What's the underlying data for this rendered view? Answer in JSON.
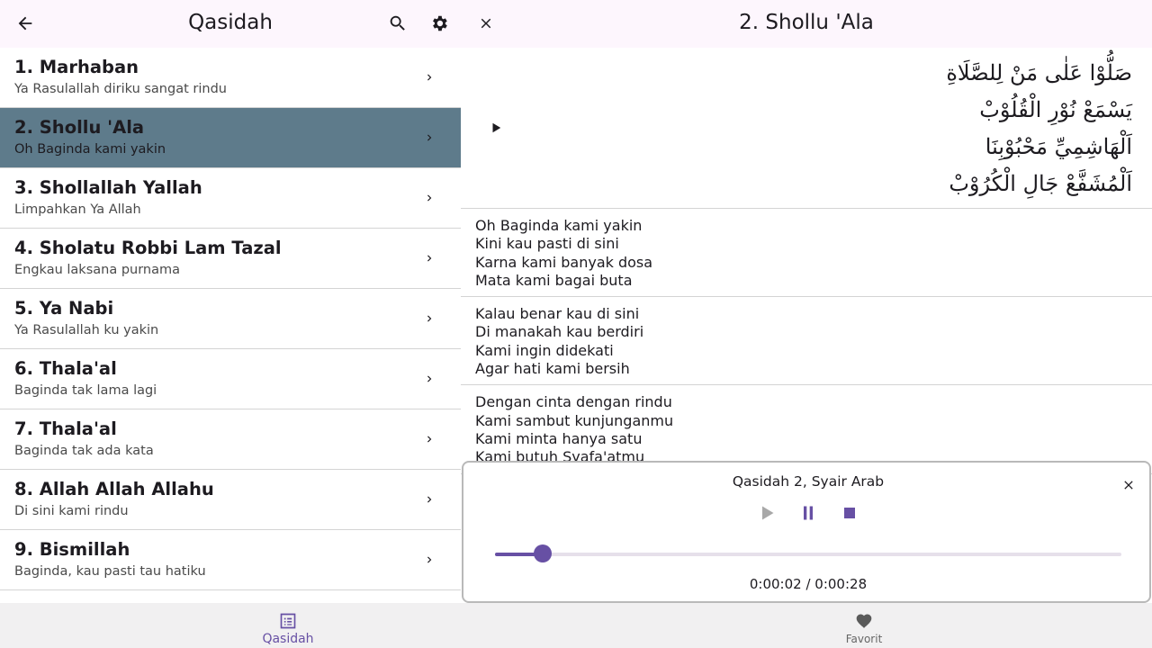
{
  "left": {
    "title": "Qasidah",
    "items": [
      {
        "title": "1. Marhaban",
        "subtitle": "Ya Rasulallah diriku sangat rindu"
      },
      {
        "title": "2. Shollu 'Ala",
        "subtitle": "Oh Baginda kami yakin"
      },
      {
        "title": "3. Shollallah Yallah",
        "subtitle": "Limpahkan Ya Allah"
      },
      {
        "title": "4. Sholatu Robbi Lam Tazal",
        "subtitle": "Engkau laksana purnama"
      },
      {
        "title": "5. Ya Nabi",
        "subtitle": "Ya Rasulallah ku yakin"
      },
      {
        "title": "6. Thala'al",
        "subtitle": "Baginda tak lama lagi"
      },
      {
        "title": "7. Thala'al",
        "subtitle": "Baginda tak ada kata"
      },
      {
        "title": "8. Allah Allah Allahu",
        "subtitle": "Di sini kami rindu"
      },
      {
        "title": "9. Bismillah",
        "subtitle": "Baginda, kau pasti tau hatiku"
      }
    ]
  },
  "right": {
    "title": "2. Shollu 'Ala",
    "arabic": [
      "صَلُّوْا عَلٰى مَنْ لِلصَّلَاةِ",
      "يَسْمَعْ نُوْرِ الْقُلُوْبْ",
      "اَلْهَاشِمِيِّ مَحْبُوْبِنَا",
      "اَلْمُشَفَّعْ جَالِ الْكُرُوْبْ"
    ],
    "stanzas": [
      [
        "Oh Baginda kami yakin",
        "Kini kau pasti di sini",
        "Karna kami banyak dosa",
        "Mata kami bagai buta"
      ],
      [
        "Kalau benar kau di sini",
        "Di manakah kau berdiri",
        "Kami ingin didekati",
        "Agar hati kami bersih"
      ],
      [
        "Dengan cinta dengan rindu",
        "Kami sambut kunjunganmu",
        "Kami minta hanya satu",
        "Kami butuh Syafa'atmu"
      ]
    ]
  },
  "player": {
    "title": "Qasidah 2, Syair Arab",
    "progress": 0.0768,
    "time": "0:00:02 / 0:00:28"
  },
  "nav": {
    "qasidah": "Qasidah",
    "favorit": "Favorit"
  },
  "colors": {
    "accent": "#6750a4",
    "selected_row": "#5e7b8b",
    "appbar": "#fdf6fd"
  }
}
